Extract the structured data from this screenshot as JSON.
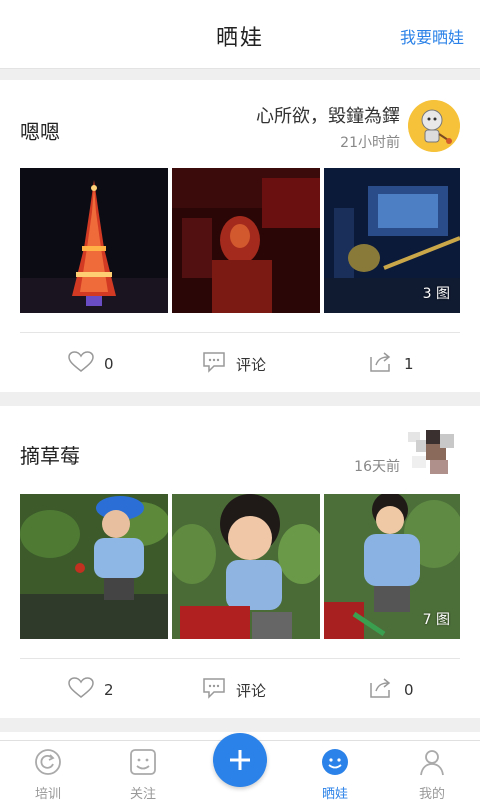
{
  "header": {
    "title": "晒娃",
    "action_label": "我要晒娃"
  },
  "posts": [
    {
      "title": "嗯嗯",
      "user_name": "心所欲，毀鐘為鐸",
      "time": "21小时前",
      "photo_count": "3 图",
      "likes": "0",
      "comment_label": "评论",
      "shares": "1"
    },
    {
      "title": "摘草莓",
      "user_name": "",
      "time": "16天前",
      "photo_count": "7 图",
      "likes": "2",
      "comment_label": "评论",
      "shares": "0"
    }
  ],
  "nav": {
    "tab1": "培训",
    "tab2": "关注",
    "tab4": "晒娃",
    "tab5": "我的"
  },
  "colors": {
    "accent": "#2b82e8",
    "text": "#222222",
    "muted": "#888888"
  }
}
